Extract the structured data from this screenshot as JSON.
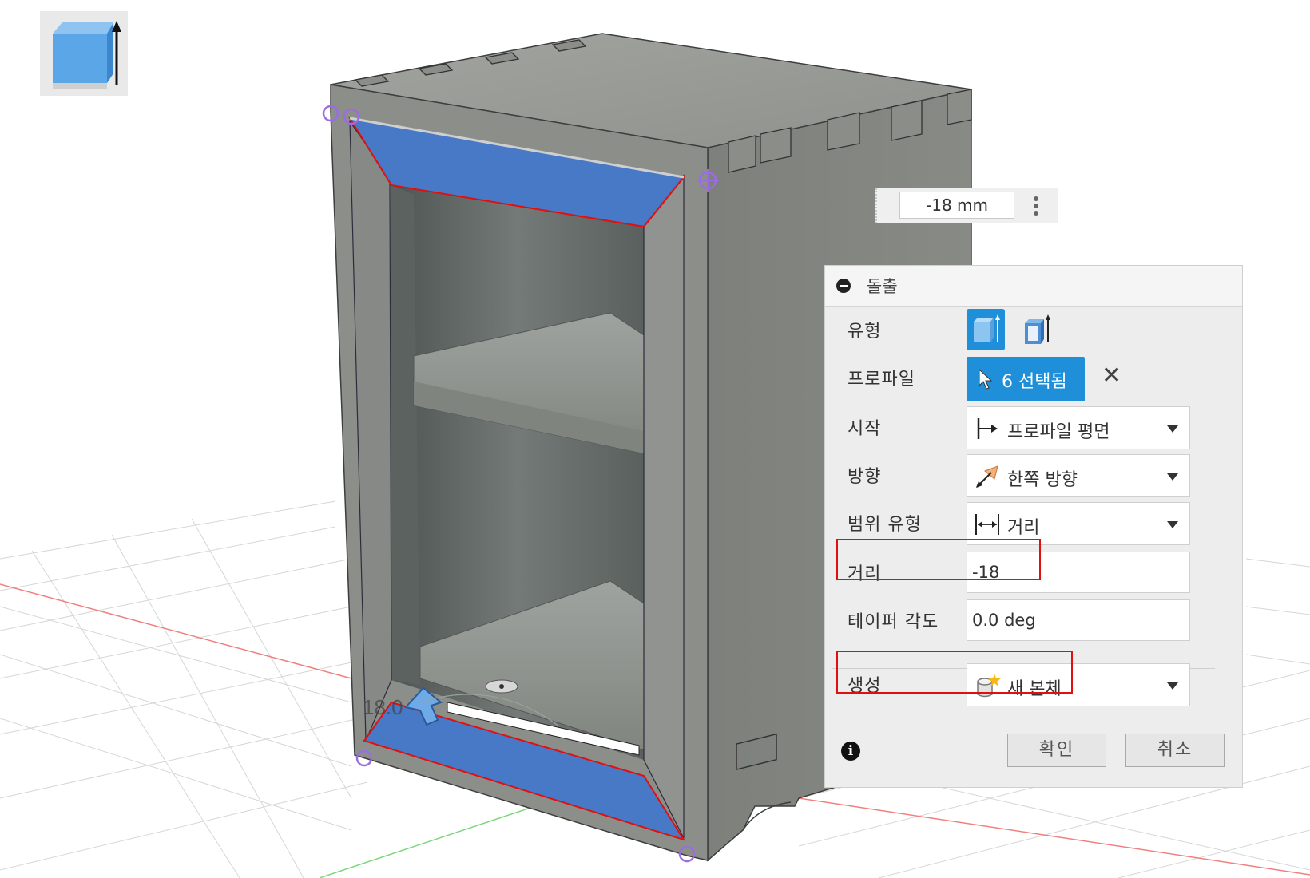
{
  "manipulator": {
    "distance_value": "-18 mm"
  },
  "viewport_label": "18.0",
  "dialog": {
    "title": "돌출",
    "rows": {
      "type": {
        "label": "유형"
      },
      "profile": {
        "label": "프로파일",
        "value": "6 선택됨"
      },
      "start": {
        "label": "시작",
        "value": "프로파일 평면"
      },
      "direction": {
        "label": "방향",
        "value": "한쪽 방향"
      },
      "extent_type": {
        "label": "범위 유형",
        "value": "거리"
      },
      "distance": {
        "label": "거리",
        "value": "-18"
      },
      "taper_angle": {
        "label": "테이퍼 각도",
        "value": "0.0 deg"
      },
      "operation": {
        "label": "생성",
        "value": "새 본체"
      }
    },
    "buttons": {
      "ok": "확인",
      "cancel": "취소"
    }
  },
  "colors": {
    "accent": "#1e8fd8",
    "highlight_red": "#e01010",
    "selection_blue": "#4378c9",
    "body_gray": "#8d908b"
  }
}
